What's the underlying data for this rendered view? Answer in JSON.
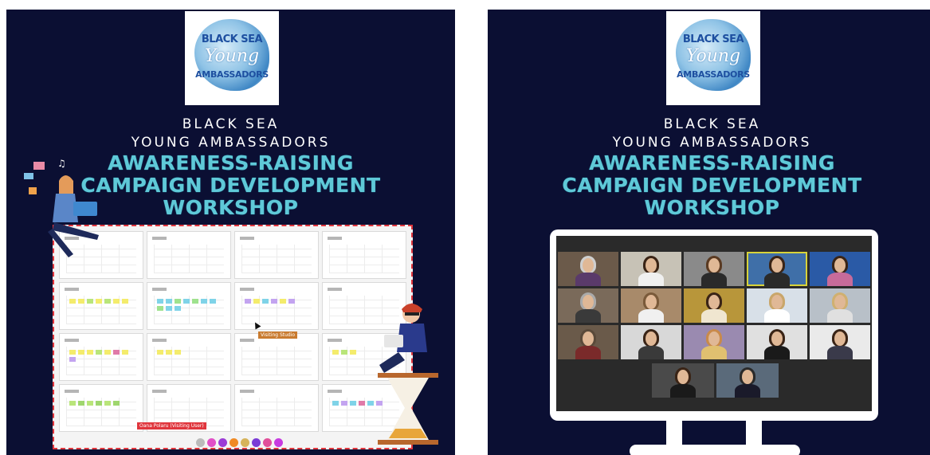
{
  "posters": [
    {
      "logo": {
        "line1": "BLACK SEA",
        "line2": "Young",
        "line3": "AMBASSADORS"
      },
      "heading": {
        "line1": "BLACK SEA",
        "line2": "YOUNG AMBASSADORS",
        "line3": "AWARENESS-RAISING",
        "line4": "CAMPAIGN DEVELOPMENT",
        "line5": "WORKSHOP"
      },
      "board": {
        "tooltip": "Visiting Studio",
        "label_chip": "Oana Polaru (Visiting User)"
      }
    },
    {
      "logo": {
        "line1": "BLACK SEA",
        "line2": "Young",
        "line3": "AMBASSADORS"
      },
      "heading": {
        "line1": "BLACK SEA",
        "line2": "YOUNG AMBASSADORS",
        "line3": "AWARENESS-RAISING",
        "line4": "CAMPAIGN DEVELOPMENT",
        "line5": "WORKSHOP"
      }
    }
  ],
  "colors": {
    "background": "#0b0f33",
    "heading_accent": "#5fc9d8",
    "board_border": "#e0363d",
    "active_speaker": "#d8d33a"
  }
}
